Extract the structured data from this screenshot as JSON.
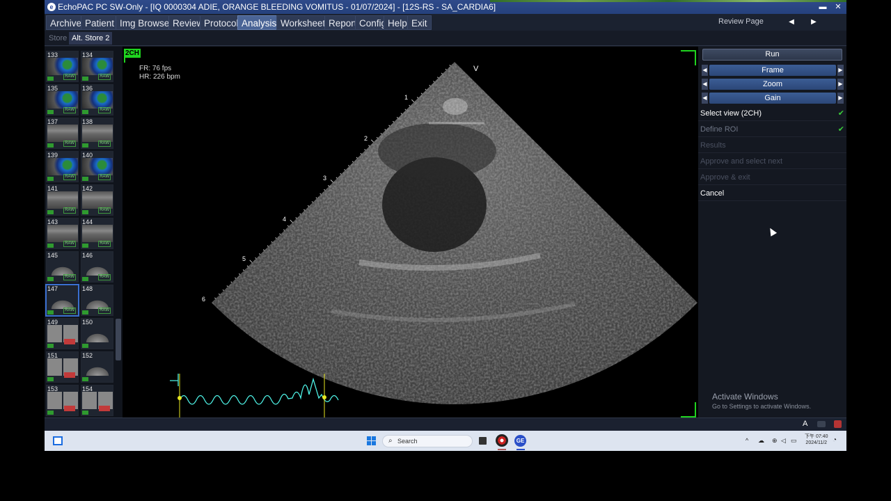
{
  "window": {
    "title": "EchoPAC PC SW-Only - [IQ 0000304 ADIE, ORANGE BLEEDING VOMITUS - 01/07/2024] - [12S-RS - SA_CARDIA6]",
    "min_icon": "minimize-icon",
    "close_icon": "close-icon"
  },
  "menu": {
    "items": [
      "Archive",
      "Patient",
      "Img Browser",
      "Review",
      "Protocol",
      "Analysis",
      "Worksheet",
      "Report",
      "Config",
      "Help",
      "Exit"
    ],
    "active": "Analysis",
    "review_page": "Review Page"
  },
  "submenu": {
    "store": "Store",
    "alt_store": "Alt. Store 2"
  },
  "thumbnails": [
    {
      "num": "133",
      "kind": "color",
      "raw": "RAW"
    },
    {
      "num": "134",
      "kind": "color",
      "raw": "RAW"
    },
    {
      "num": "135",
      "kind": "color",
      "raw": "RAW"
    },
    {
      "num": "136",
      "kind": "color",
      "raw": "RAW"
    },
    {
      "num": "137",
      "kind": "gray",
      "raw": "RAW"
    },
    {
      "num": "138",
      "kind": "gray",
      "raw": "RAW"
    },
    {
      "num": "139",
      "kind": "color",
      "raw": "RAW"
    },
    {
      "num": "140",
      "kind": "color",
      "raw": "RAW"
    },
    {
      "num": "141",
      "kind": "gray",
      "raw": "RAW"
    },
    {
      "num": "142",
      "kind": "gray",
      "raw": "RAW"
    },
    {
      "num": "143",
      "kind": "gray",
      "raw": "RAW"
    },
    {
      "num": "144",
      "kind": "gray",
      "raw": "RAW"
    },
    {
      "num": "145",
      "kind": "fan",
      "raw": "RAW"
    },
    {
      "num": "146",
      "kind": "fan",
      "raw": "RAW"
    },
    {
      "num": "147",
      "kind": "fan",
      "raw": "RAW",
      "selected": true
    },
    {
      "num": "148",
      "kind": "fan",
      "raw": "RAW"
    },
    {
      "num": "149",
      "kind": "quad",
      "raw": ""
    },
    {
      "num": "150",
      "kind": "fan",
      "raw": ""
    },
    {
      "num": "151",
      "kind": "quad",
      "raw": ""
    },
    {
      "num": "152",
      "kind": "fan",
      "raw": ""
    },
    {
      "num": "153",
      "kind": "quad",
      "raw": ""
    },
    {
      "num": "154",
      "kind": "quad",
      "raw": ""
    }
  ],
  "viewer": {
    "view_label": "2CH",
    "fr": "FR: 76 fps",
    "hr": "HR: 226 bpm",
    "orientation": "V",
    "depth_marks": [
      "1",
      "2",
      "3",
      "4",
      "5",
      "6"
    ]
  },
  "panel": {
    "run": "Run",
    "controls": [
      "Frame",
      "Zoom",
      "Gain"
    ],
    "steps": [
      {
        "label": "Select view (2CH)",
        "state": "enabled",
        "checked": true
      },
      {
        "label": "Define ROI",
        "state": "semi",
        "checked": true
      },
      {
        "label": "Results",
        "state": "disabled",
        "checked": false
      },
      {
        "label": "Approve and select next",
        "state": "disabled",
        "checked": false
      },
      {
        "label": "Approve & exit",
        "state": "disabled",
        "checked": false
      },
      {
        "label": "Cancel",
        "state": "enabled",
        "checked": false
      }
    ],
    "watermark_title": "Activate Windows",
    "watermark_sub": "Go to Settings to activate Windows."
  },
  "statusbar": {
    "font_glyph": "A"
  },
  "taskbar": {
    "search_placeholder": "Search",
    "time": "下午 07:40",
    "date": "2024/11/2",
    "app2_glyph": "GE"
  },
  "colors": {
    "accent": "#1fd41f",
    "menu_active": "#4a6496",
    "check": "#3acc3a"
  }
}
